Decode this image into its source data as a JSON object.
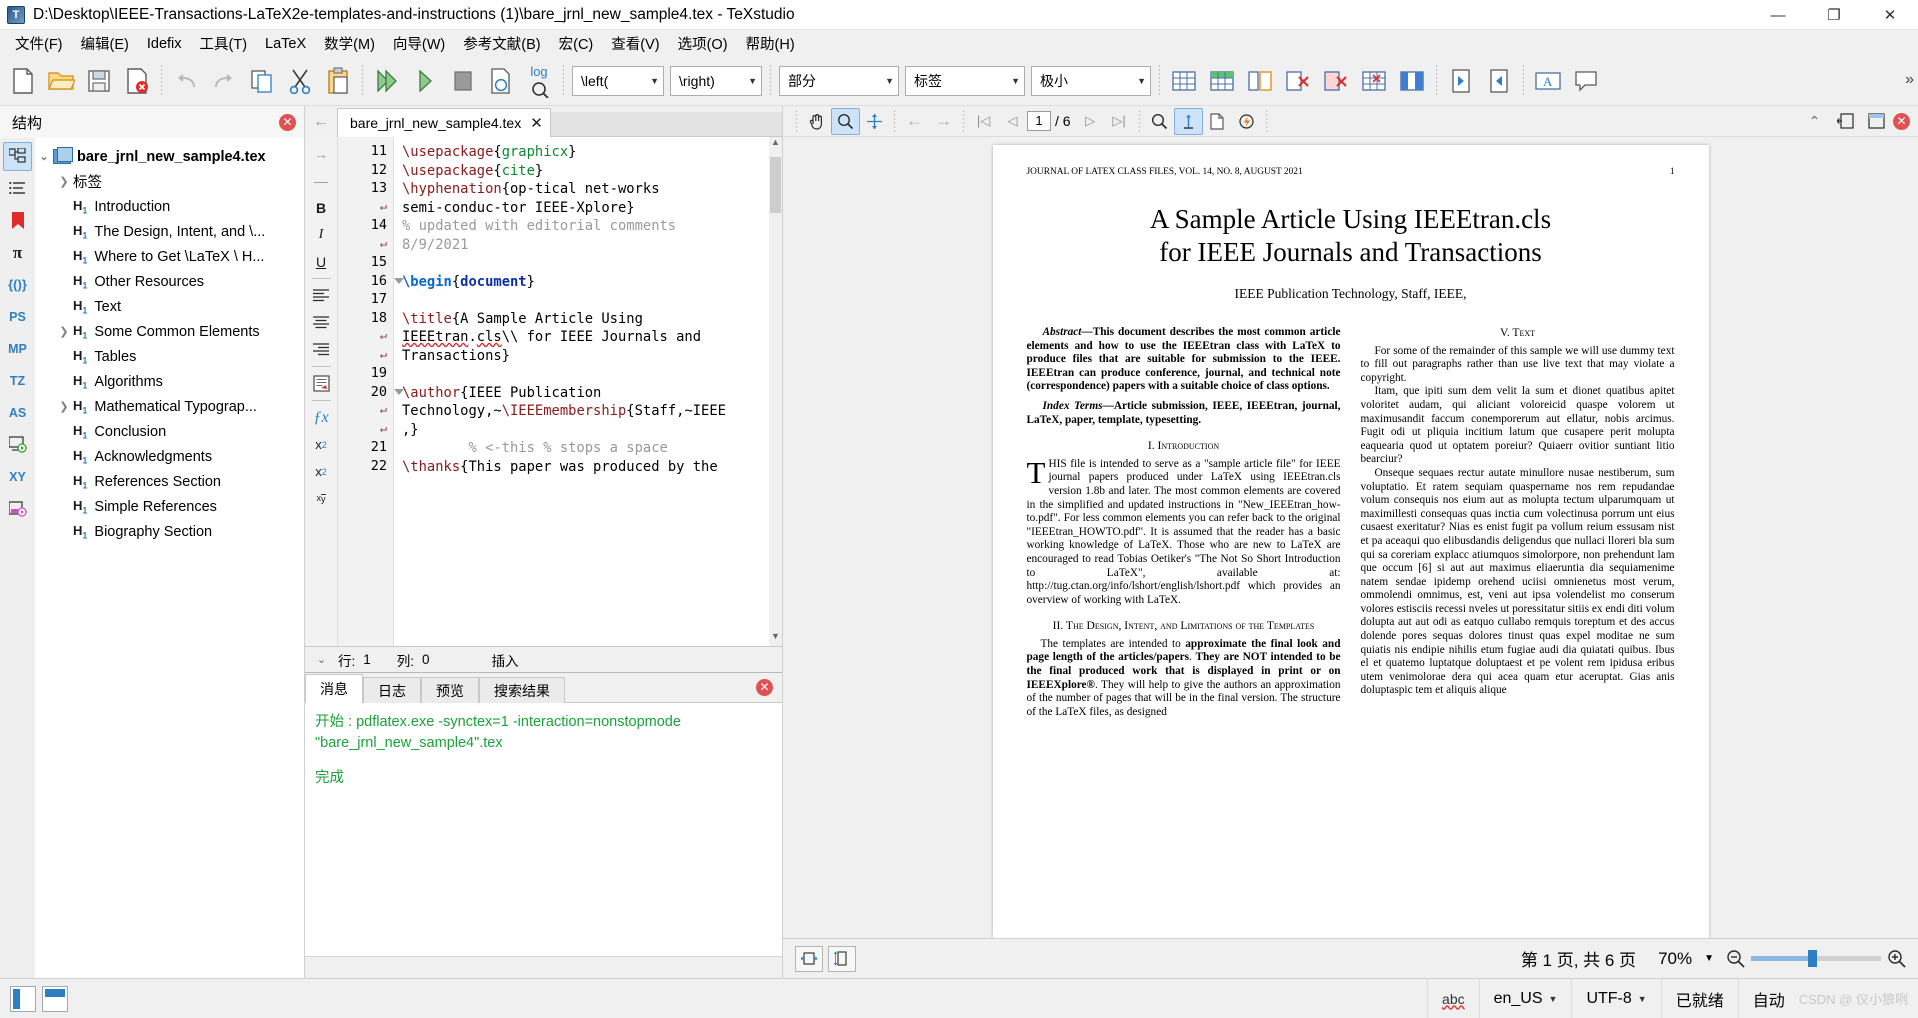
{
  "window": {
    "title": "D:\\Desktop\\IEEE-Transactions-LaTeX2e-templates-and-instructions (1)\\bare_jrnl_new_sample4.tex - TeXstudio",
    "minimize": "—",
    "maximize": "❐",
    "close": "✕"
  },
  "menubar": {
    "items": [
      "文件(F)",
      "编辑(E)",
      "Idefix",
      "工具(T)",
      "LaTeX",
      "数学(M)",
      "向导(W)",
      "参考文献(B)",
      "宏(C)",
      "查看(V)",
      "选项(O)",
      "帮助(H)"
    ]
  },
  "toolbar": {
    "combos": [
      {
        "label": "\\left(",
        "name": "left-delimiter-combo"
      },
      {
        "label": "\\right)",
        "name": "right-delimiter-combo"
      },
      {
        "label": "部分",
        "name": "section-level-combo"
      },
      {
        "label": "标签",
        "name": "label-combo"
      },
      {
        "label": "极小",
        "name": "size-combo"
      }
    ],
    "overflow": "»",
    "log_label": "log"
  },
  "structure": {
    "title": "结构",
    "close": "✕",
    "rail": [
      "structure-icon",
      "list-icon",
      "bookmark-icon",
      "pi-icon",
      "braces-icon",
      "PS",
      "MP",
      "TZ",
      "AS",
      "console-icon",
      "XY",
      "magenta-icon"
    ],
    "rail_labels": [
      "",
      "",
      "",
      "π",
      "{()}",
      "PS",
      "MP",
      "TZ",
      "AS",
      "",
      "XY",
      ""
    ],
    "root": "bare_jrnl_new_sample4.tex",
    "labels_node": "标签",
    "items": [
      {
        "label": "Introduction",
        "expandable": false
      },
      {
        "label": "The Design, Intent, and \\...",
        "expandable": false
      },
      {
        "label": "Where to Get \\LaTeX \\ H...",
        "expandable": false
      },
      {
        "label": "Other Resources",
        "expandable": false
      },
      {
        "label": "Text",
        "expandable": false
      },
      {
        "label": "Some Common Elements",
        "expandable": true
      },
      {
        "label": "Tables",
        "expandable": false
      },
      {
        "label": "Algorithms",
        "expandable": false
      },
      {
        "label": "Mathematical Typograp...",
        "expandable": true
      },
      {
        "label": "Conclusion",
        "expandable": false
      },
      {
        "label": "Acknowledgments",
        "expandable": false
      },
      {
        "label": "References Section",
        "expandable": false
      },
      {
        "label": "Simple References",
        "expandable": false
      },
      {
        "label": "Biography Section",
        "expandable": false
      }
    ]
  },
  "editor": {
    "tab_label": "bare_jrnl_new_sample4.tex",
    "tab_close": "✕",
    "back_arrow": "←",
    "format_rail": [
      "→",
      "—",
      "B",
      "I",
      "U",
      "align-left-icon",
      "align-center-icon",
      "align-justify-icon",
      "comment-icon",
      "ƒx",
      "x₂",
      "x²",
      "x/y"
    ],
    "lines": [
      {
        "num": "11",
        "fold": false,
        "wrap": false
      },
      {
        "num": "12",
        "fold": false,
        "wrap": false
      },
      {
        "num": "13",
        "fold": false,
        "wrap": false
      },
      {
        "num": "",
        "fold": false,
        "wrap": true
      },
      {
        "num": "14",
        "fold": false,
        "wrap": false
      },
      {
        "num": "",
        "fold": false,
        "wrap": true
      },
      {
        "num": "15",
        "fold": false,
        "wrap": false
      },
      {
        "num": "16",
        "fold": true,
        "wrap": false
      },
      {
        "num": "17",
        "fold": false,
        "wrap": false
      },
      {
        "num": "18",
        "fold": false,
        "wrap": false
      },
      {
        "num": "",
        "fold": false,
        "wrap": true
      },
      {
        "num": "",
        "fold": false,
        "wrap": true
      },
      {
        "num": "19",
        "fold": false,
        "wrap": false
      },
      {
        "num": "20",
        "fold": true,
        "wrap": false
      },
      {
        "num": "",
        "fold": false,
        "wrap": true
      },
      {
        "num": "",
        "fold": false,
        "wrap": true
      },
      {
        "num": "21",
        "fold": false,
        "wrap": false
      },
      {
        "num": "22",
        "fold": false,
        "wrap": false
      }
    ],
    "status": {
      "row_label": "行:",
      "row_value": "1",
      "col_label": "列:",
      "col_value": "0",
      "mode": "插入",
      "chevron": "⌄"
    }
  },
  "log": {
    "tabs": [
      "消息",
      "日志",
      "预览",
      "搜索结果"
    ],
    "active_tab": "消息",
    "close": "✕",
    "line1": "开始 : pdflatex.exe -synctex=1 -interaction=nonstopmode",
    "line2": "\"bare_jrnl_new_sample4\".tex",
    "line3": "完成"
  },
  "pdf": {
    "toolbar": {
      "page_value": "1",
      "page_total": "/ 6",
      "first": "|◁",
      "prev": "◁",
      "next": "▷",
      "last": "▷|",
      "back": "←",
      "forward": "→"
    },
    "status": {
      "page_info": "第 1 页, 共 6 页",
      "zoom": "70%",
      "zoom_out": "－",
      "zoom_in": "＋"
    },
    "document": {
      "header_left": "JOURNAL OF LATEX CLASS FILES, VOL. 14, NO. 8, AUGUST 2021",
      "header_right": "1",
      "title_line1": "A Sample Article Using IEEEtran.cls",
      "title_line2": "for IEEE Journals and Transactions",
      "authors": "IEEE Publication Technology, Staff, IEEE,",
      "abstract_label": "Abstract",
      "abstract": "—This document describes the most common article elements and how to use the IEEEtran class with LaTeX to produce files that are suitable for submission to the IEEE. IEEEtran can produce conference, journal, and technical note (correspondence) papers with a suitable choice of class options.",
      "index_label": "Index Terms",
      "index_terms": "—Article submission, IEEE, IEEEtran, journal, LaTeX, paper, template, typesetting.",
      "sec1": "I.  Introduction",
      "sec1_drop": "T",
      "sec1_body": "HIS file is intended to serve as a \"sample article file\" for IEEE journal papers produced under LaTeX using IEEEtran.cls version 1.8b and later. The most common elements are covered in the simplified and updated instructions in \"New_IEEEtran_how-to.pdf\". For less common elements you can refer back to the original \"IEEEtran_HOWTO.pdf\". It is assumed that the reader has a basic working knowledge of LaTeX. Those who are new to LaTeX are encouraged to read Tobias Oetiker's \"The Not So Short Introduction to LaTeX\", available at: http://tug.ctan.org/info/lshort/english/lshort.pdf which provides an overview of working with LaTeX.",
      "sec2": "II.  The Design, Intent, and Limitations of the Templates",
      "sec2_body_a": "The templates are intended to ",
      "sec2_bold_a": "approximate the final look and page length of the articles/papers",
      "sec2_body_b": ". ",
      "sec2_bold_b": "They are NOT intended to be the final produced work that is displayed in print or on IEEEXplore®",
      "sec2_body_c": ". They will help to give the authors an approximation of the number of pages that will be in the final version. The structure of the LaTeX files, as designed",
      "sec5": "V.  Text",
      "sec5_p1": "For some of the remainder of this sample we will use dummy text to fill out paragraphs rather than use live text that may violate a copyright.",
      "sec5_p2": "Itam, que ipiti sum dem velit la sum et dionet quatibus apitet voloritet audam, qui aliciant voloreicid quaspe volorem ut maximusandit faccum conemporerum aut ellatur, nobis arcimus. Fugit odi ut pliquia incitium latum que cusapere perit molupta eaquearia quod ut optatem poreiur? Quiaerr ovitior suntiant litio bearciur?",
      "sec5_p3": "Onseque sequaes rectur autate minullore nusae nestiberum, sum voluptatio. Et ratem sequiam quaspername nos rem repudandae volum consequis nos eium aut as molupta tectum ulparumquam ut maximillesti consequas quas inctia cum volectinusa porrum unt eius cusaest exeritatur? Nias es enist fugit pa vollum reium essusam nist et pa aceaqui quo elibusdandis deligendus que nullaci lloreri bla sum qui sa coreriam explacc atiumquos simolorpore, non prehendunt lam que occum [6] si aut aut maximus eliaeruntia dia sequiamenime natem sendae ipidemp orehend uciisi omnienetus most verum, ommolendi omnimus, est, veni aut ipsa volendelist mo conserum volores estisciis recessi nveles ut poressitatur sitiis ex endi diti volum dolupta aut aut odi as eatquo cullabo remquis toreptum et des accus dolende pores sequas dolores tinust quas expel moditae ne sum quiatis nis endipie nihilis etum fugiae audi dia quiatati quibus. Ibus el et quatemo luptatque doluptaest et pe volent rem ipidusa eribus utem venimolorae dera qui acea quam etur aceruptat. Gias anis doluptaspic tem et aliquis alique"
    }
  },
  "statusbar": {
    "spell": "abc",
    "language": "en_US",
    "encoding": "UTF-8",
    "ready": "已就绪",
    "auto": "自动",
    "watermark": "CSDN @ 仪小狼咧",
    "carat": "⌄"
  }
}
